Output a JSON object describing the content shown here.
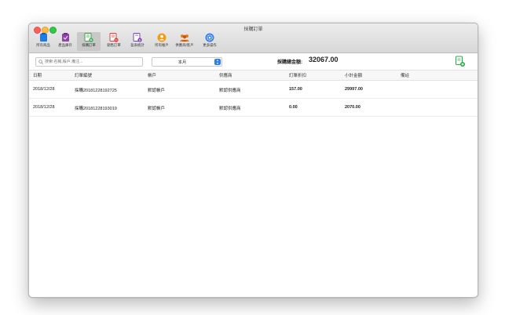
{
  "window": {
    "title": "採購訂單"
  },
  "toolbar": {
    "items": [
      {
        "label": "所有商品",
        "icon": "products-icon",
        "color": "#1e7be6"
      },
      {
        "label": "產品庫存",
        "icon": "inventory-icon",
        "color": "#8e44ad"
      },
      {
        "label": "採購訂單",
        "icon": "purchase-order-icon",
        "color": "#2ea84a",
        "active": true
      },
      {
        "label": "銷售訂單",
        "icon": "sales-order-icon",
        "color": "#e03b3b"
      },
      {
        "label": "盈表統計",
        "icon": "statistics-icon",
        "color": "#7b3fb5"
      },
      {
        "label": "所有帳戶",
        "icon": "account-icon",
        "color": "#f39c12"
      },
      {
        "label": "供應商/客戶",
        "icon": "suppliers-icon",
        "color": "#e67e22"
      },
      {
        "label": "更多操作",
        "icon": "gear-icon",
        "color": "#2f7ef4"
      }
    ]
  },
  "filters": {
    "search_placeholder": "搜索:名稱,帳戶,備注...",
    "period": "本月",
    "total_label": "採購總金額:",
    "total_value": "32067.00"
  },
  "table": {
    "columns": [
      "日期",
      "訂單編號",
      "帳戶",
      "供應商",
      "訂單折扣",
      "小計金額",
      "備註"
    ],
    "rows": [
      [
        "2018/12/28",
        "採購20181228192725",
        "默認帳戶",
        "默認供應商",
        "157.00",
        "29997.00",
        ""
      ],
      [
        "2018/12/28",
        "採購20181228193019",
        "默認帳戶",
        "默認供應商",
        "0.00",
        "2070.00",
        ""
      ]
    ]
  }
}
